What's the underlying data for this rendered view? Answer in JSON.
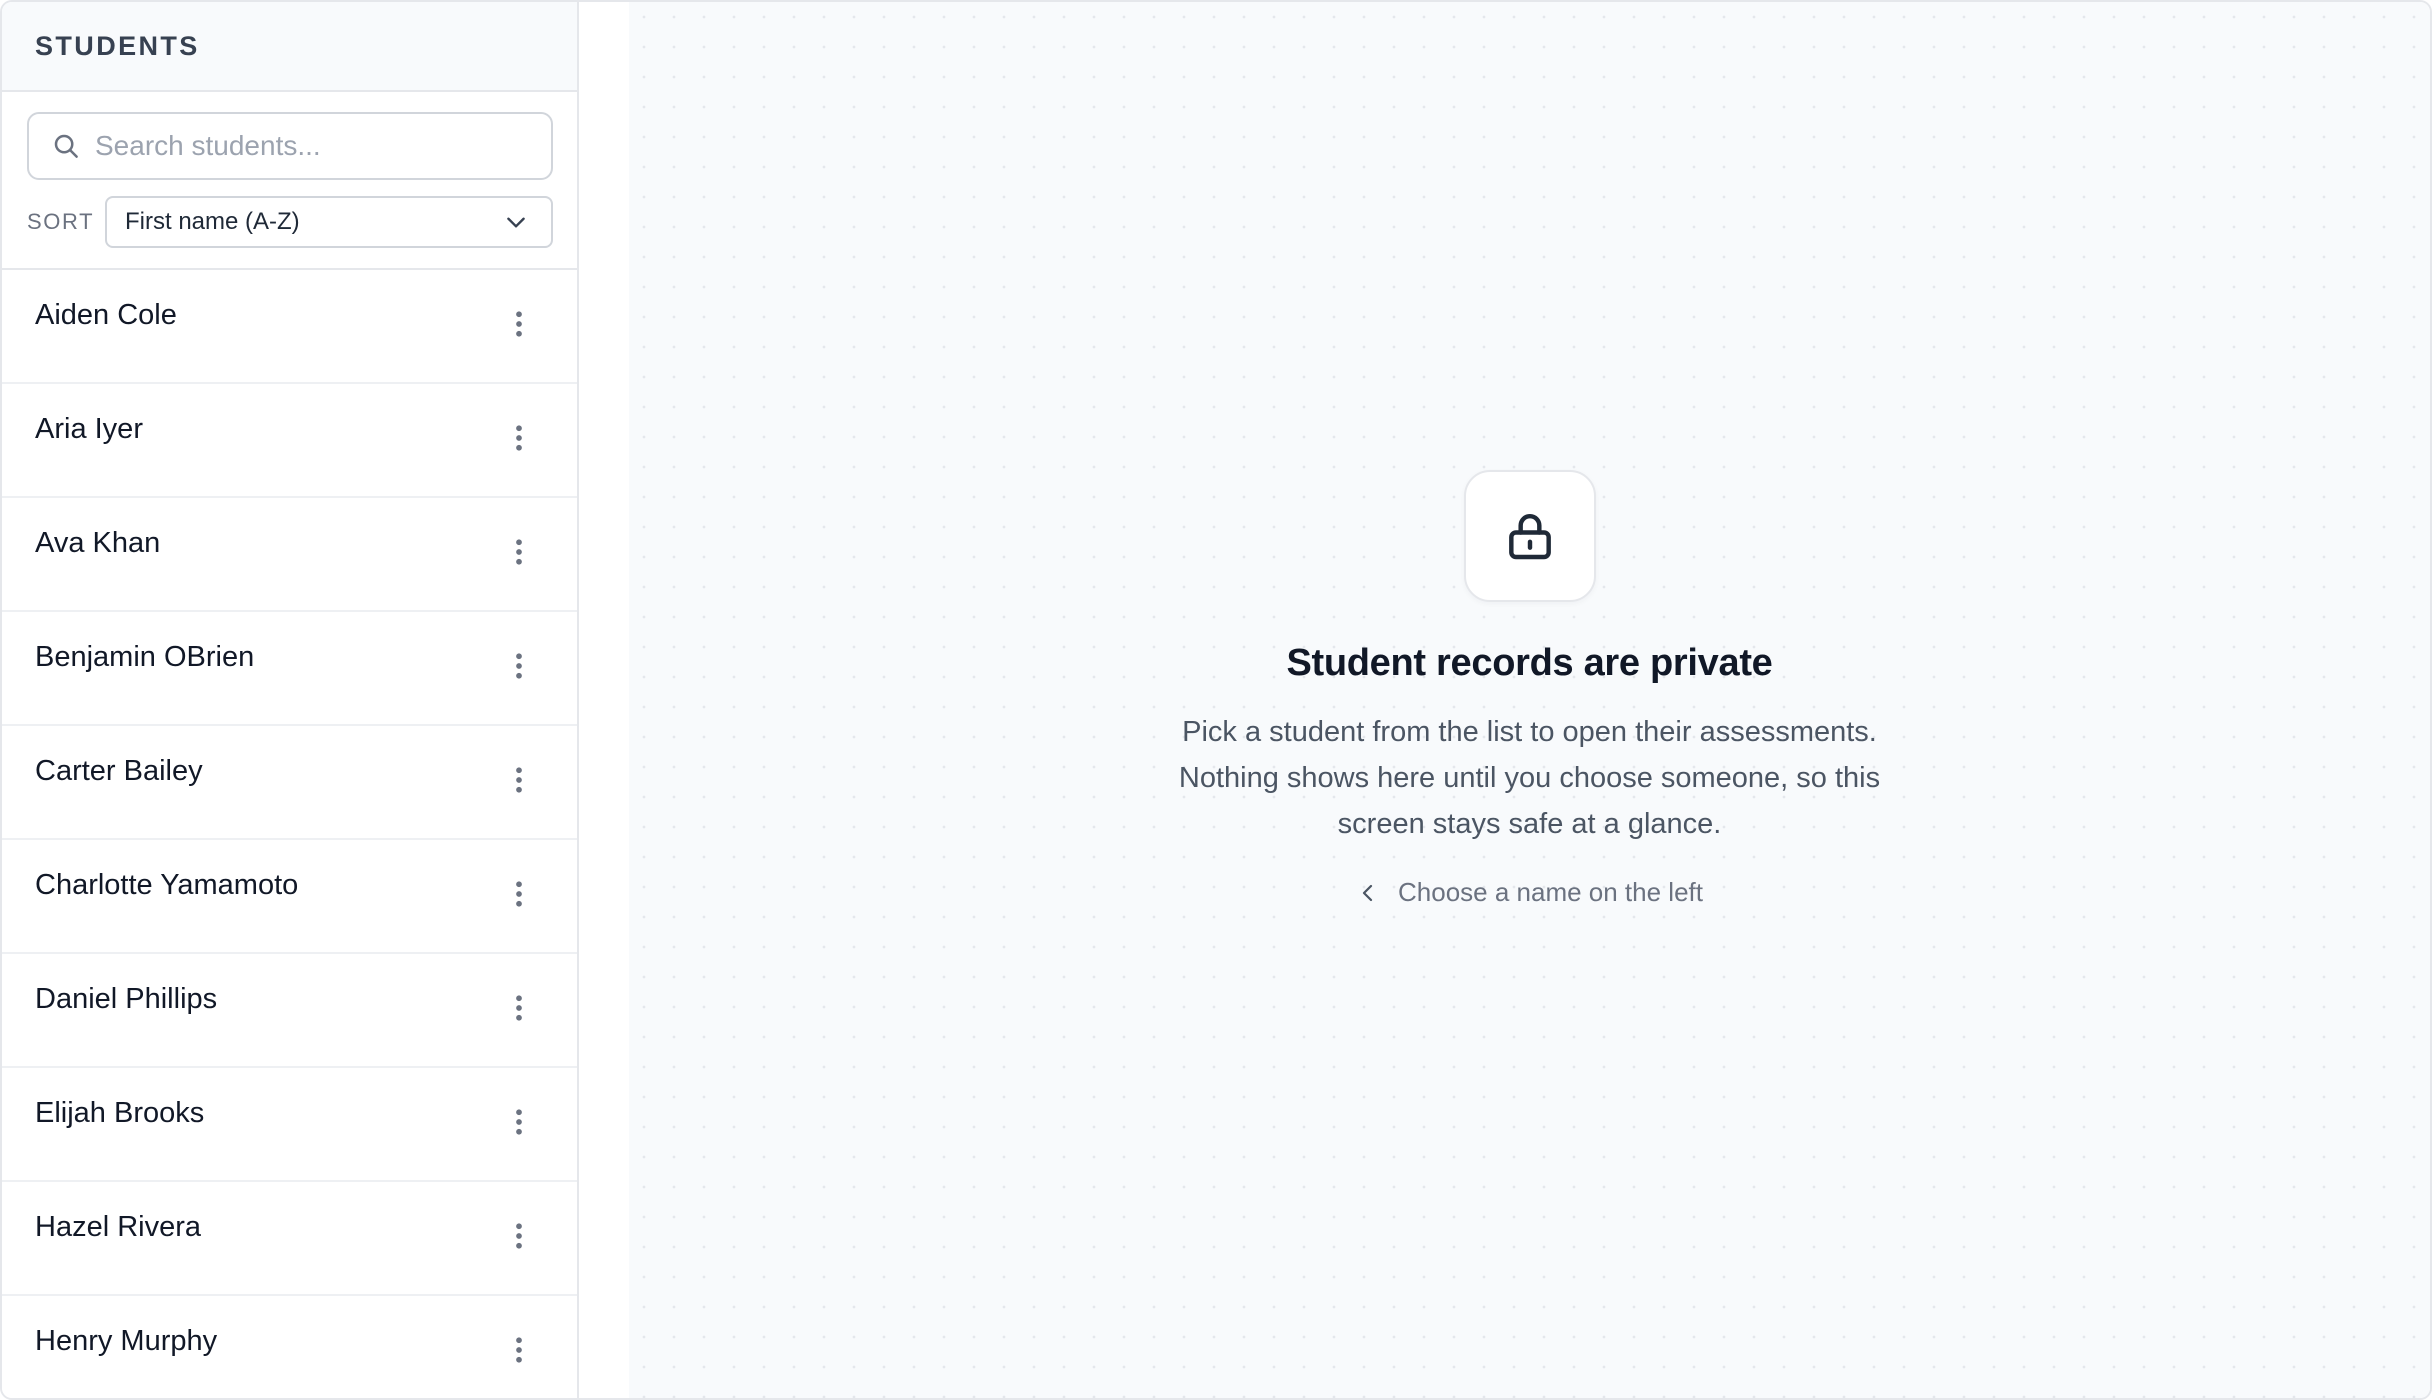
{
  "sidebar": {
    "title": "STUDENTS",
    "search": {
      "placeholder": "Search students...",
      "value": ""
    },
    "sort": {
      "label": "SORT",
      "selected": "First name (A-Z)"
    },
    "students": [
      {
        "name": "Aiden Cole"
      },
      {
        "name": "Aria Iyer"
      },
      {
        "name": "Ava Khan"
      },
      {
        "name": "Benjamin OBrien"
      },
      {
        "name": "Carter Bailey"
      },
      {
        "name": "Charlotte Yamamoto"
      },
      {
        "name": "Daniel Phillips"
      },
      {
        "name": "Elijah Brooks"
      },
      {
        "name": "Hazel Rivera"
      },
      {
        "name": "Henry Murphy"
      }
    ]
  },
  "main": {
    "icon": "lock-icon",
    "title": "Student records are private",
    "description": "Pick a student from the list to open their assessments. Nothing shows here until you choose someone, so this screen stays safe at a glance.",
    "hint_icon": "chevron-left-icon",
    "hint": "Choose a name on the left"
  },
  "colors": {
    "border": "#e5e7eb",
    "header_bg": "#f8fafc",
    "text_primary": "#111827",
    "text_muted": "#6b7280",
    "icon_gray": "#6b7280",
    "main_bg": "#f8fafc"
  }
}
